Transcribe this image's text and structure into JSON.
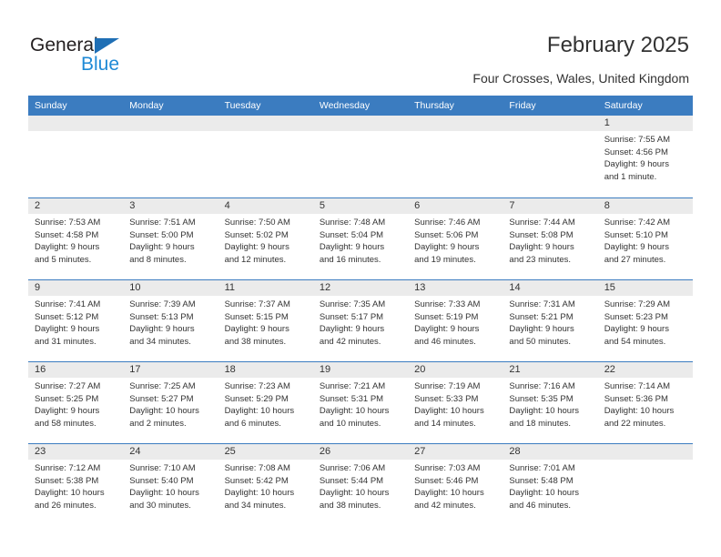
{
  "brand": {
    "name_part1": "General",
    "name_part2": "Blue",
    "triangle_color": "#1f6fb5",
    "blue_color": "#1f8ad6"
  },
  "header": {
    "title": "February 2025",
    "subtitle": "Four Crosses, Wales, United Kingdom"
  },
  "theme": {
    "header_blue": "#3b7cc0",
    "numband_gray": "#ebebeb",
    "text_color": "#333333"
  },
  "weekday_headers": [
    "Sunday",
    "Monday",
    "Tuesday",
    "Wednesday",
    "Thursday",
    "Friday",
    "Saturday"
  ],
  "weeks": [
    [
      {
        "day": "",
        "lines": []
      },
      {
        "day": "",
        "lines": []
      },
      {
        "day": "",
        "lines": []
      },
      {
        "day": "",
        "lines": []
      },
      {
        "day": "",
        "lines": []
      },
      {
        "day": "",
        "lines": []
      },
      {
        "day": "1",
        "lines": [
          "Sunrise: 7:55 AM",
          "Sunset: 4:56 PM",
          "Daylight: 9 hours",
          "and 1 minute."
        ]
      }
    ],
    [
      {
        "day": "2",
        "lines": [
          "Sunrise: 7:53 AM",
          "Sunset: 4:58 PM",
          "Daylight: 9 hours",
          "and 5 minutes."
        ]
      },
      {
        "day": "3",
        "lines": [
          "Sunrise: 7:51 AM",
          "Sunset: 5:00 PM",
          "Daylight: 9 hours",
          "and 8 minutes."
        ]
      },
      {
        "day": "4",
        "lines": [
          "Sunrise: 7:50 AM",
          "Sunset: 5:02 PM",
          "Daylight: 9 hours",
          "and 12 minutes."
        ]
      },
      {
        "day": "5",
        "lines": [
          "Sunrise: 7:48 AM",
          "Sunset: 5:04 PM",
          "Daylight: 9 hours",
          "and 16 minutes."
        ]
      },
      {
        "day": "6",
        "lines": [
          "Sunrise: 7:46 AM",
          "Sunset: 5:06 PM",
          "Daylight: 9 hours",
          "and 19 minutes."
        ]
      },
      {
        "day": "7",
        "lines": [
          "Sunrise: 7:44 AM",
          "Sunset: 5:08 PM",
          "Daylight: 9 hours",
          "and 23 minutes."
        ]
      },
      {
        "day": "8",
        "lines": [
          "Sunrise: 7:42 AM",
          "Sunset: 5:10 PM",
          "Daylight: 9 hours",
          "and 27 minutes."
        ]
      }
    ],
    [
      {
        "day": "9",
        "lines": [
          "Sunrise: 7:41 AM",
          "Sunset: 5:12 PM",
          "Daylight: 9 hours",
          "and 31 minutes."
        ]
      },
      {
        "day": "10",
        "lines": [
          "Sunrise: 7:39 AM",
          "Sunset: 5:13 PM",
          "Daylight: 9 hours",
          "and 34 minutes."
        ]
      },
      {
        "day": "11",
        "lines": [
          "Sunrise: 7:37 AM",
          "Sunset: 5:15 PM",
          "Daylight: 9 hours",
          "and 38 minutes."
        ]
      },
      {
        "day": "12",
        "lines": [
          "Sunrise: 7:35 AM",
          "Sunset: 5:17 PM",
          "Daylight: 9 hours",
          "and 42 minutes."
        ]
      },
      {
        "day": "13",
        "lines": [
          "Sunrise: 7:33 AM",
          "Sunset: 5:19 PM",
          "Daylight: 9 hours",
          "and 46 minutes."
        ]
      },
      {
        "day": "14",
        "lines": [
          "Sunrise: 7:31 AM",
          "Sunset: 5:21 PM",
          "Daylight: 9 hours",
          "and 50 minutes."
        ]
      },
      {
        "day": "15",
        "lines": [
          "Sunrise: 7:29 AM",
          "Sunset: 5:23 PM",
          "Daylight: 9 hours",
          "and 54 minutes."
        ]
      }
    ],
    [
      {
        "day": "16",
        "lines": [
          "Sunrise: 7:27 AM",
          "Sunset: 5:25 PM",
          "Daylight: 9 hours",
          "and 58 minutes."
        ]
      },
      {
        "day": "17",
        "lines": [
          "Sunrise: 7:25 AM",
          "Sunset: 5:27 PM",
          "Daylight: 10 hours",
          "and 2 minutes."
        ]
      },
      {
        "day": "18",
        "lines": [
          "Sunrise: 7:23 AM",
          "Sunset: 5:29 PM",
          "Daylight: 10 hours",
          "and 6 minutes."
        ]
      },
      {
        "day": "19",
        "lines": [
          "Sunrise: 7:21 AM",
          "Sunset: 5:31 PM",
          "Daylight: 10 hours",
          "and 10 minutes."
        ]
      },
      {
        "day": "20",
        "lines": [
          "Sunrise: 7:19 AM",
          "Sunset: 5:33 PM",
          "Daylight: 10 hours",
          "and 14 minutes."
        ]
      },
      {
        "day": "21",
        "lines": [
          "Sunrise: 7:16 AM",
          "Sunset: 5:35 PM",
          "Daylight: 10 hours",
          "and 18 minutes."
        ]
      },
      {
        "day": "22",
        "lines": [
          "Sunrise: 7:14 AM",
          "Sunset: 5:36 PM",
          "Daylight: 10 hours",
          "and 22 minutes."
        ]
      }
    ],
    [
      {
        "day": "23",
        "lines": [
          "Sunrise: 7:12 AM",
          "Sunset: 5:38 PM",
          "Daylight: 10 hours",
          "and 26 minutes."
        ]
      },
      {
        "day": "24",
        "lines": [
          "Sunrise: 7:10 AM",
          "Sunset: 5:40 PM",
          "Daylight: 10 hours",
          "and 30 minutes."
        ]
      },
      {
        "day": "25",
        "lines": [
          "Sunrise: 7:08 AM",
          "Sunset: 5:42 PM",
          "Daylight: 10 hours",
          "and 34 minutes."
        ]
      },
      {
        "day": "26",
        "lines": [
          "Sunrise: 7:06 AM",
          "Sunset: 5:44 PM",
          "Daylight: 10 hours",
          "and 38 minutes."
        ]
      },
      {
        "day": "27",
        "lines": [
          "Sunrise: 7:03 AM",
          "Sunset: 5:46 PM",
          "Daylight: 10 hours",
          "and 42 minutes."
        ]
      },
      {
        "day": "28",
        "lines": [
          "Sunrise: 7:01 AM",
          "Sunset: 5:48 PM",
          "Daylight: 10 hours",
          "and 46 minutes."
        ]
      },
      {
        "day": "",
        "lines": []
      }
    ]
  ]
}
